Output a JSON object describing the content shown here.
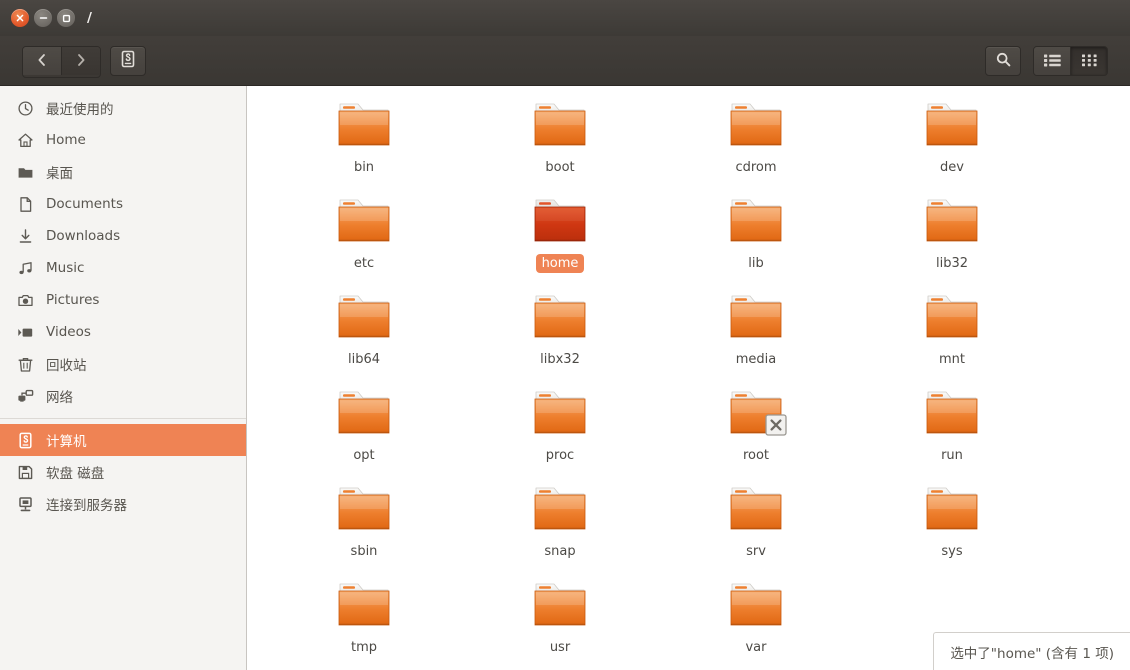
{
  "window": {
    "title": "/",
    "buttons": {
      "close": "close-button",
      "minimize": "minimize-button",
      "maximize": "maximize-button"
    }
  },
  "toolbar": {
    "back_icon": "chevron-left-icon",
    "forward_icon": "chevron-right-icon",
    "location_icon": "computer-icon",
    "search_icon": "search-icon",
    "list_view_icon": "list-view-icon",
    "grid_view_icon": "grid-view-icon",
    "active_view": "grid"
  },
  "sidebar": {
    "items": [
      {
        "label": "最近使用的",
        "icon": "clock-icon",
        "selected": false
      },
      {
        "label": "Home",
        "icon": "home-icon",
        "selected": false
      },
      {
        "label": "桌面",
        "icon": "folder-icon",
        "selected": false
      },
      {
        "label": "Documents",
        "icon": "document-icon",
        "selected": false
      },
      {
        "label": "Downloads",
        "icon": "download-icon",
        "selected": false
      },
      {
        "label": "Music",
        "icon": "music-note-icon",
        "selected": false
      },
      {
        "label": "Pictures",
        "icon": "camera-icon",
        "selected": false
      },
      {
        "label": "Videos",
        "icon": "video-icon",
        "selected": false
      },
      {
        "label": "回收站",
        "icon": "trash-icon",
        "selected": false
      },
      {
        "label": "网络",
        "icon": "network-icon",
        "selected": false
      }
    ],
    "items_below": [
      {
        "label": "计算机",
        "icon": "computer-icon",
        "selected": true
      },
      {
        "label": "软盘 磁盘",
        "icon": "floppy-disk-icon",
        "selected": false
      },
      {
        "label": "连接到服务器",
        "icon": "connect-server-icon",
        "selected": false
      }
    ]
  },
  "files": [
    {
      "name": "bin",
      "selected": false,
      "emblem": null
    },
    {
      "name": "boot",
      "selected": false,
      "emblem": null
    },
    {
      "name": "cdrom",
      "selected": false,
      "emblem": null
    },
    {
      "name": "dev",
      "selected": false,
      "emblem": null
    },
    {
      "name": "etc",
      "selected": false,
      "emblem": null
    },
    {
      "name": "home",
      "selected": true,
      "emblem": null
    },
    {
      "name": "lib",
      "selected": false,
      "emblem": null
    },
    {
      "name": "lib32",
      "selected": false,
      "emblem": null
    },
    {
      "name": "lib64",
      "selected": false,
      "emblem": null
    },
    {
      "name": "libx32",
      "selected": false,
      "emblem": null
    },
    {
      "name": "media",
      "selected": false,
      "emblem": null
    },
    {
      "name": "mnt",
      "selected": false,
      "emblem": null
    },
    {
      "name": "opt",
      "selected": false,
      "emblem": null
    },
    {
      "name": "proc",
      "selected": false,
      "emblem": null
    },
    {
      "name": "root",
      "selected": false,
      "emblem": "access-denied-icon"
    },
    {
      "name": "run",
      "selected": false,
      "emblem": null
    },
    {
      "name": "sbin",
      "selected": false,
      "emblem": null
    },
    {
      "name": "snap",
      "selected": false,
      "emblem": null
    },
    {
      "name": "srv",
      "selected": false,
      "emblem": null
    },
    {
      "name": "sys",
      "selected": false,
      "emblem": null
    },
    {
      "name": "tmp",
      "selected": false,
      "emblem": null
    },
    {
      "name": "usr",
      "selected": false,
      "emblem": null
    },
    {
      "name": "var",
      "selected": false,
      "emblem": null
    }
  ],
  "status": {
    "text": "选中了\"home\" (含有 1 项)"
  },
  "colors": {
    "accent_orange": "#ef8354",
    "titlebar_dark": "#3d3a36",
    "toolbar_dark": "#423e3a",
    "sidebar_bg": "#f5f4f2",
    "folder_orange": "#e8731f",
    "folder_selected": "#cf3914"
  }
}
